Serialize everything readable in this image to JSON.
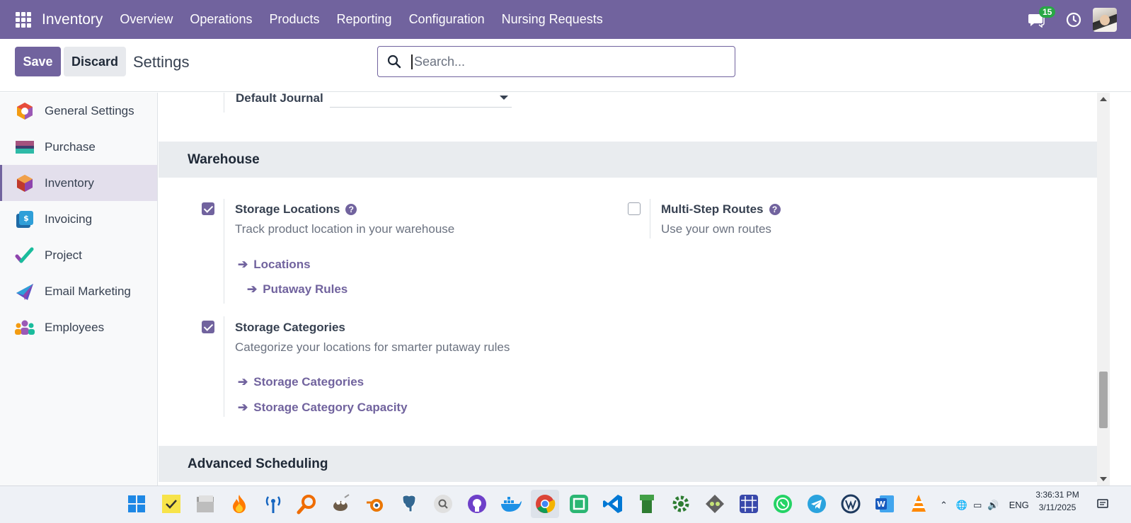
{
  "navbar": {
    "brand": "Inventory",
    "menu": [
      "Overview",
      "Operations",
      "Products",
      "Reporting",
      "Configuration",
      "Nursing Requests"
    ],
    "chat_count": "15"
  },
  "control_panel": {
    "save_label": "Save",
    "discard_label": "Discard",
    "breadcrumb": "Settings",
    "search_placeholder": "Search..."
  },
  "sidebar": {
    "items": [
      {
        "label": "General Settings",
        "icon": "general-settings-icon"
      },
      {
        "label": "Purchase",
        "icon": "purchase-icon"
      },
      {
        "label": "Inventory",
        "icon": "inventory-icon",
        "active": true
      },
      {
        "label": "Invoicing",
        "icon": "invoicing-icon"
      },
      {
        "label": "Project",
        "icon": "project-icon"
      },
      {
        "label": "Email Marketing",
        "icon": "email-marketing-icon"
      },
      {
        "label": "Employees",
        "icon": "employees-icon"
      }
    ]
  },
  "content": {
    "default_journal_label": "Default Journal",
    "default_journal_value": "",
    "warehouse": {
      "title": "Warehouse",
      "storage_locations": {
        "title": "Storage Locations",
        "description": "Track product location in your warehouse",
        "checked": true,
        "links": [
          "Locations",
          "Putaway Rules"
        ]
      },
      "multi_step_routes": {
        "title": "Multi-Step Routes",
        "description": "Use your own routes",
        "checked": false
      },
      "storage_categories": {
        "title": "Storage Categories",
        "description": "Categorize your locations for smarter putaway rules",
        "checked": true,
        "links": [
          "Storage Categories",
          "Storage Category Capacity"
        ]
      }
    },
    "advanced_scheduling": {
      "title": "Advanced Scheduling"
    }
  },
  "taskbar": {
    "language": "ENG",
    "time": "3:36:31 PM",
    "date": "3/11/2025"
  },
  "colors": {
    "brand": "#71639e",
    "section_band": "#e9ecef"
  }
}
